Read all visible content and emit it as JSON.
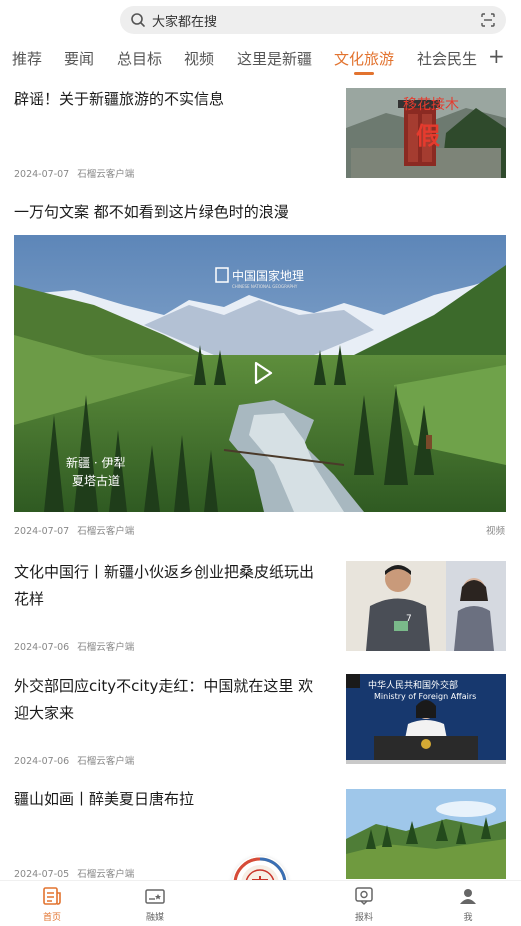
{
  "search": {
    "placeholder": "大家都在搜"
  },
  "tabs": [
    {
      "label": "推荐"
    },
    {
      "label": "要闻"
    },
    {
      "label": "总目标"
    },
    {
      "label": "视频"
    },
    {
      "label": "这里是新疆"
    },
    {
      "label": "文化旅游",
      "active": true
    },
    {
      "label": "社会民生"
    }
  ],
  "news": [
    {
      "title": "辟谣！关于新疆旅游的不实信息",
      "date": "2024-07-07",
      "source": "石榴云客户端",
      "thumb_text_top": "移花接木",
      "thumb_text_big": "假"
    },
    {
      "title": "一万句文案 都不如看到这片绿色时的浪漫",
      "date": "2024-07-07",
      "source": "石榴云客户端",
      "tag": "视频",
      "video_logo": "中国国家地理",
      "video_logo_sub": "CHINESE NATIONAL GEOGRAPHY",
      "video_caption_1": "新疆 · 伊犁",
      "video_caption_2": "夏塔古道"
    },
    {
      "title_line1": "文化中国行丨新疆小伙返乡创业把桑皮纸玩出",
      "title_line2": "花样",
      "date": "2024-07-06",
      "source": "石榴云客户端"
    },
    {
      "title_line1": "外交部回应city不city走红：中国就在这里 欢",
      "title_line2": "迎大家来",
      "date": "2024-07-06",
      "source": "石榴云客户端",
      "thumb_text_1": "中华人民共和国外交部",
      "thumb_text_2": "Ministry of Foreign Affairs"
    },
    {
      "title": "疆山如画丨醉美夏日唐布拉",
      "date": "2024-07-05",
      "source": "石榴云客户端"
    }
  ],
  "bottom_nav": [
    {
      "label": "首页",
      "active": true,
      "icon": "news-icon"
    },
    {
      "label": "融媒",
      "icon": "media-icon"
    },
    {
      "label": "报料",
      "icon": "tip-icon"
    },
    {
      "label": "我",
      "icon": "user-icon"
    }
  ],
  "colors": {
    "accent": "#e2732f"
  }
}
